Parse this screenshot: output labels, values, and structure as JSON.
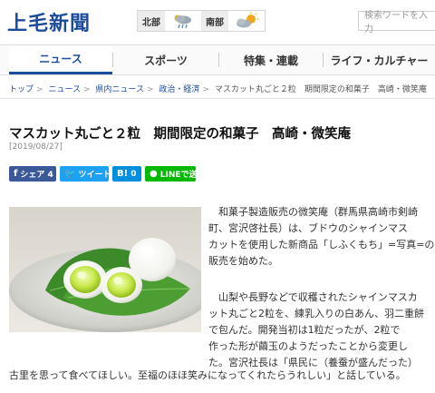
{
  "site": {
    "logo": "上毛新聞"
  },
  "weather": [
    {
      "region": "北部",
      "icon": "cloud-rain-icon"
    },
    {
      "region": "南部",
      "icon": "cloud-sun-icon"
    }
  ],
  "search": {
    "placeholder": "検索ワードを入力"
  },
  "nav": {
    "tabs": [
      {
        "label": "ニュース"
      },
      {
        "label": "スポーツ"
      },
      {
        "label": "特集・連載"
      },
      {
        "label": "ライフ・カルチャー"
      }
    ]
  },
  "breadcrumb": [
    "トップ",
    "ニュース",
    "県内ニュース",
    "政治・経済",
    "マスカット丸ごと２粒　期間限定の和菓子　高崎・微笑庵"
  ],
  "article": {
    "title": "マスカット丸ごと２粒　期間限定の和菓子　高崎・微笑庵",
    "date": "[2019/08/27]",
    "paragraph1": [
      "和菓子製造販売の微笑庵（群馬県高崎市剣崎",
      "町、宮沢啓社長）は、ブドウのシャインマス",
      "カットを使用した新商品「しふくもち」=写真=の",
      "販売を始めた。"
    ],
    "paragraph2": [
      "山梨や長野などで収穫されたシャインマスカ",
      "ット丸ごと2粒を、練乳入りの白あん、羽二重餅",
      "で包んだ。開発当初は1粒だったが、2粒で",
      "作った形が繭玉のようだったことから変更し",
      "た。宮沢社長は「県民に（養蚕が盛んだった）"
    ],
    "paragraph3": "古里を思って食べてほしい。至福のほほ笑みになってくれたらうれしい」と話している。"
  },
  "share": {
    "facebook": "シェア 4",
    "twitter": "ツイート",
    "hatena": "0",
    "line": "LINEで送る"
  },
  "colors": {
    "brand": "#1c4c9c",
    "facebook": "#3b5998",
    "twitter": "#1da1f2",
    "hatena": "#008fde",
    "line": "#00b900"
  }
}
